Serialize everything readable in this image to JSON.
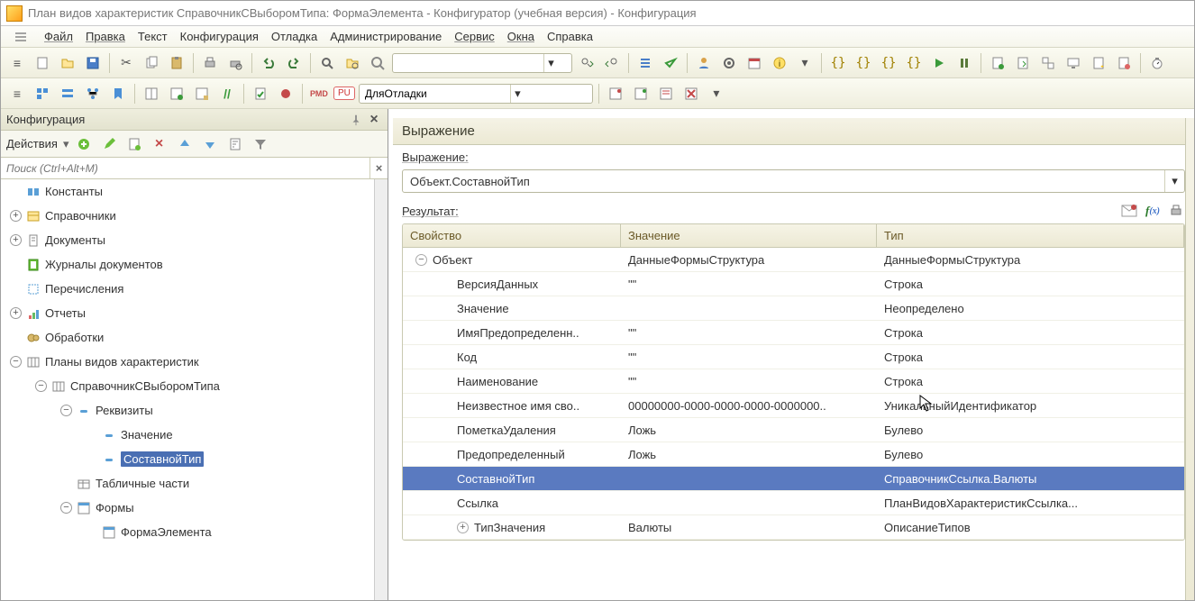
{
  "title": "План видов характеристик СправочникСВыборомТипа: ФормаЭлемента - Конфигуратор (учебная версия) - Конфигурация",
  "menu": [
    "Файл",
    "Правка",
    "Текст",
    "Конфигурация",
    "Отладка",
    "Администрирование",
    "Сервис",
    "Окна",
    "Справка"
  ],
  "toolbar2": {
    "combo_value": "ДляОтладки",
    "red_badge": "PU"
  },
  "config_panel": {
    "title": "Конфигурация",
    "actions_label": "Действия",
    "search_placeholder": "Поиск (Ctrl+Alt+M)",
    "tree": [
      {
        "level": 1,
        "exp": null,
        "icon": "const",
        "label": "Константы"
      },
      {
        "level": 1,
        "exp": "+",
        "icon": "ref",
        "label": "Справочники"
      },
      {
        "level": 1,
        "exp": "+",
        "icon": "doc",
        "label": "Документы"
      },
      {
        "level": 1,
        "exp": null,
        "icon": "journal",
        "label": "Журналы документов"
      },
      {
        "level": 1,
        "exp": null,
        "icon": "enum",
        "label": "Перечисления"
      },
      {
        "level": 1,
        "exp": "+",
        "icon": "report",
        "label": "Отчеты"
      },
      {
        "level": 1,
        "exp": null,
        "icon": "proc",
        "label": "Обработки"
      },
      {
        "level": 1,
        "exp": "-",
        "icon": "pvh",
        "label": "Планы видов характеристик"
      },
      {
        "level": 2,
        "exp": "-",
        "icon": "pvh",
        "label": "СправочникСВыборомТипа"
      },
      {
        "level": 3,
        "exp": "-",
        "icon": "attr",
        "label": "Реквизиты"
      },
      {
        "level": 4,
        "exp": null,
        "icon": "attr",
        "label": "Значение"
      },
      {
        "level": 4,
        "exp": null,
        "icon": "attr",
        "label": "СоставнойТип",
        "selected": true
      },
      {
        "level": 3,
        "exp": null,
        "icon": "tab",
        "label": "Табличные части"
      },
      {
        "level": 3,
        "exp": "-",
        "icon": "form",
        "label": "Формы"
      },
      {
        "level": 4,
        "exp": null,
        "icon": "form",
        "label": "ФормаЭлемента"
      }
    ]
  },
  "right_panel": {
    "header": "Выражение",
    "expr_label": "Выражение:",
    "expr_value": "Объект.СоставнойТип",
    "result_label": "Результат:",
    "fx_label": "f(x)",
    "columns": {
      "prop": "Свойство",
      "val": "Значение",
      "typ": "Тип"
    },
    "rows": [
      {
        "indent": 0,
        "exp": "-",
        "prop": "Объект",
        "val": "ДанныеФормыСтруктура",
        "typ": "ДанныеФормыСтруктура"
      },
      {
        "indent": 1,
        "exp": null,
        "prop": "ВерсияДанных",
        "val": "\"\"",
        "typ": "Строка"
      },
      {
        "indent": 1,
        "exp": null,
        "prop": "Значение",
        "val": "",
        "typ": "Неопределено"
      },
      {
        "indent": 1,
        "exp": null,
        "prop": "ИмяПредопределенн..",
        "val": "\"\"",
        "typ": "Строка"
      },
      {
        "indent": 1,
        "exp": null,
        "prop": "Код",
        "val": "\"\"",
        "typ": "Строка"
      },
      {
        "indent": 1,
        "exp": null,
        "prop": "Наименование",
        "val": "\"\"",
        "typ": "Строка"
      },
      {
        "indent": 1,
        "exp": null,
        "prop": "Неизвестное имя сво..",
        "val": "00000000-0000-0000-0000-0000000..",
        "typ": "УникальныйИдентификатор"
      },
      {
        "indent": 1,
        "exp": null,
        "prop": "ПометкаУдаления",
        "val": "Ложь",
        "typ": "Булево"
      },
      {
        "indent": 1,
        "exp": null,
        "prop": "Предопределенный",
        "val": "Ложь",
        "typ": "Булево"
      },
      {
        "indent": 1,
        "exp": null,
        "prop": "СоставнойТип",
        "val": "",
        "typ": "СправочникСсылка.Валюты",
        "selected": true
      },
      {
        "indent": 1,
        "exp": null,
        "prop": "Ссылка",
        "val": "",
        "typ": "ПланВидовХарактеристикСсылка..."
      },
      {
        "indent": 1,
        "exp": "+",
        "prop": "ТипЗначения",
        "val": "Валюты",
        "typ": "ОписаниеТипов"
      }
    ]
  }
}
